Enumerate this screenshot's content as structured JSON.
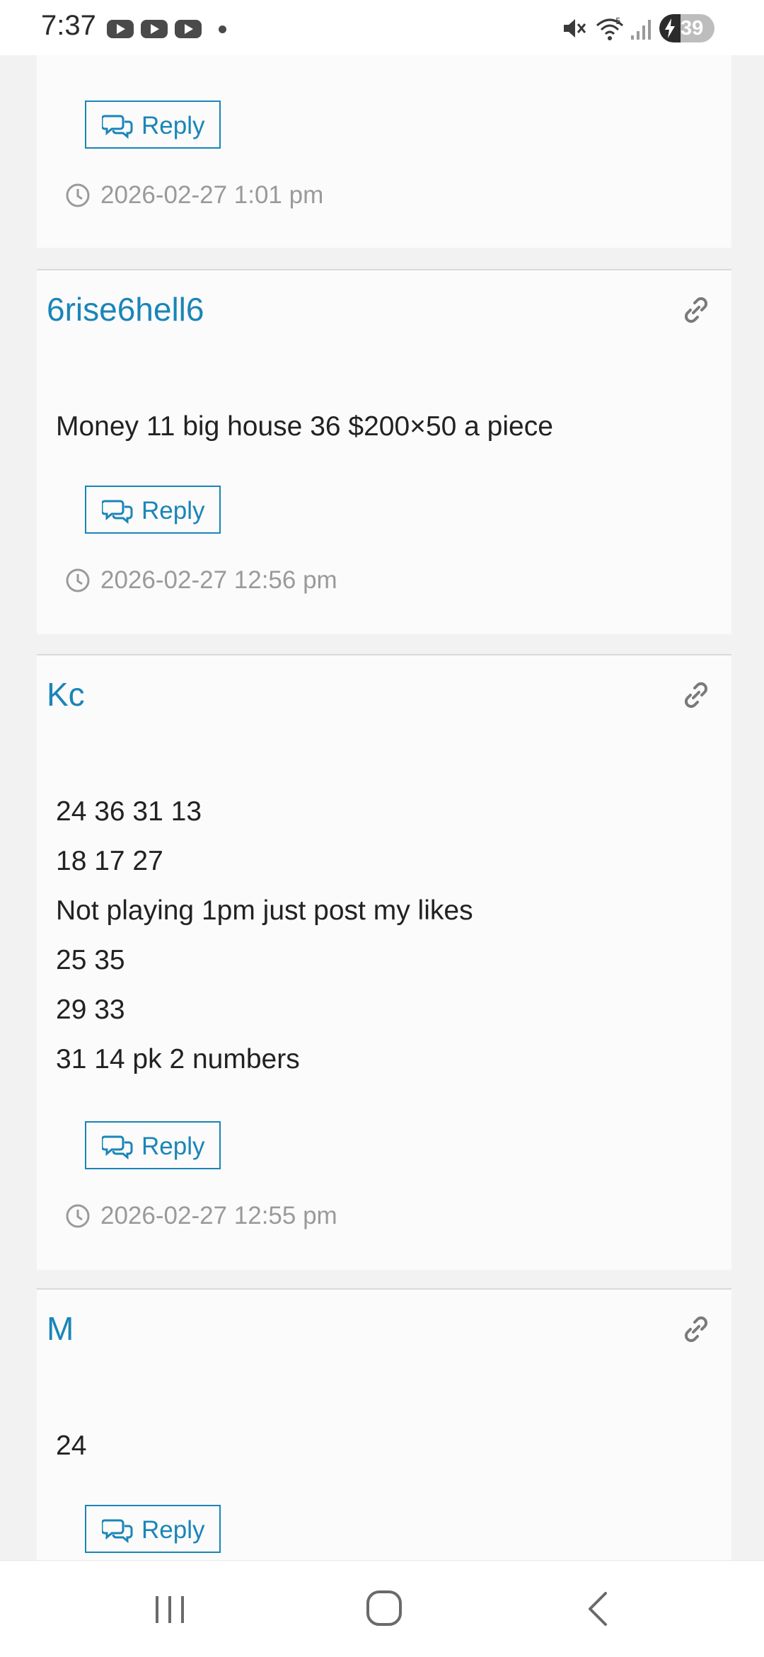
{
  "status_bar": {
    "time": "7:37",
    "notification_icons": [
      "youtube-icon",
      "youtube-icon",
      "youtube-icon"
    ],
    "battery_percent": "39",
    "wifi_label": "5"
  },
  "comments": [
    {
      "author": "",
      "body": [],
      "reply_label": "Reply",
      "timestamp": "2026-02-27 1:01 pm"
    },
    {
      "author": "6rise6hell6",
      "body": [
        "Money 11 big house 36 $200×50 a piece"
      ],
      "reply_label": "Reply",
      "timestamp": "2026-02-27 12:56 pm"
    },
    {
      "author": "Kc",
      "body": [
        "24 36 31 13",
        "18 17 27",
        "Not playing 1pm just post my likes",
        "25 35",
        "29 33",
        "31 14 pk 2 numbers"
      ],
      "reply_label": "Reply",
      "timestamp": "2026-02-27 12:55 pm"
    },
    {
      "author": "M",
      "body": [
        "24"
      ],
      "reply_label": "Reply",
      "timestamp": ""
    }
  ],
  "colors": {
    "accent": "#1a85b8",
    "meta_text": "#9a9a9a",
    "card_bg": "#fbfbfb"
  },
  "nav_bar": {
    "icons": [
      "recent-apps-icon",
      "home-icon",
      "back-icon"
    ]
  }
}
